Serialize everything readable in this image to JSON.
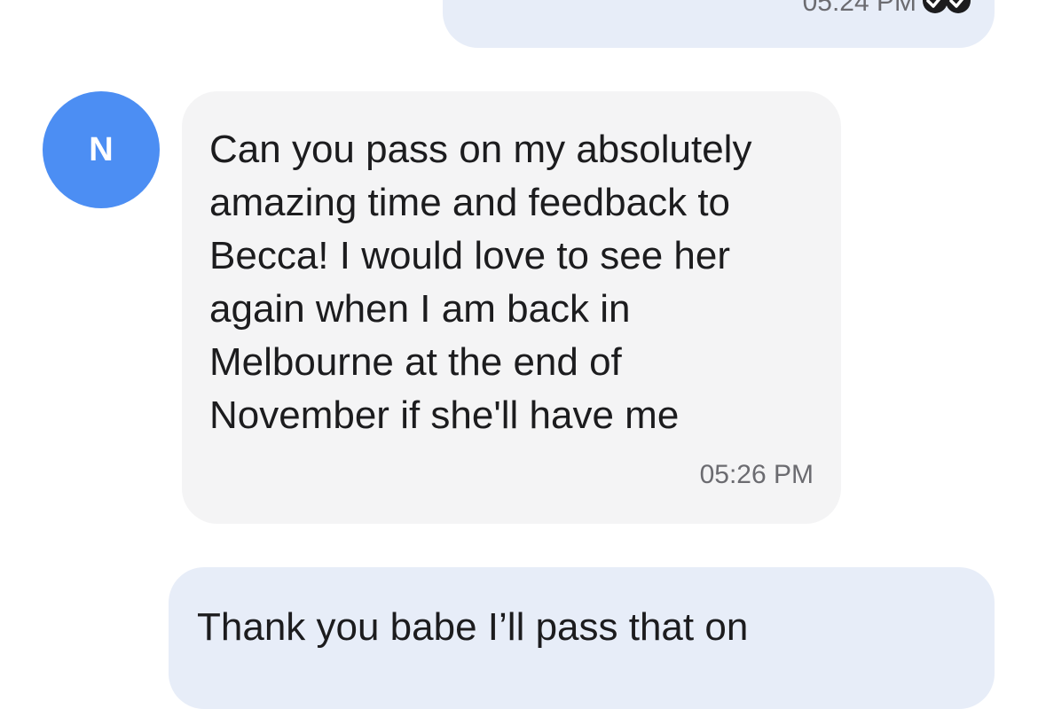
{
  "colors": {
    "avatar_bg": "#4c8ef3",
    "incoming_bubble": "#f4f4f5",
    "outgoing_bubble": "#e7edf8",
    "timestamp": "#6b6b70"
  },
  "messages": [
    {
      "direction": "outgoing",
      "text": "",
      "time": "05:24 PM",
      "status_icon": "double-check-read-icon"
    },
    {
      "direction": "incoming",
      "sender_initial": "N",
      "text": "Can you pass on my absolutely\namazing time and feedback to\nBecca! I would love to see her\nagain when I am back in\nMelbourne at the end of\nNovember if she'll have me",
      "time": "05:26 PM"
    },
    {
      "direction": "outgoing",
      "text": "Thank you babe I’ll pass that on"
    }
  ]
}
